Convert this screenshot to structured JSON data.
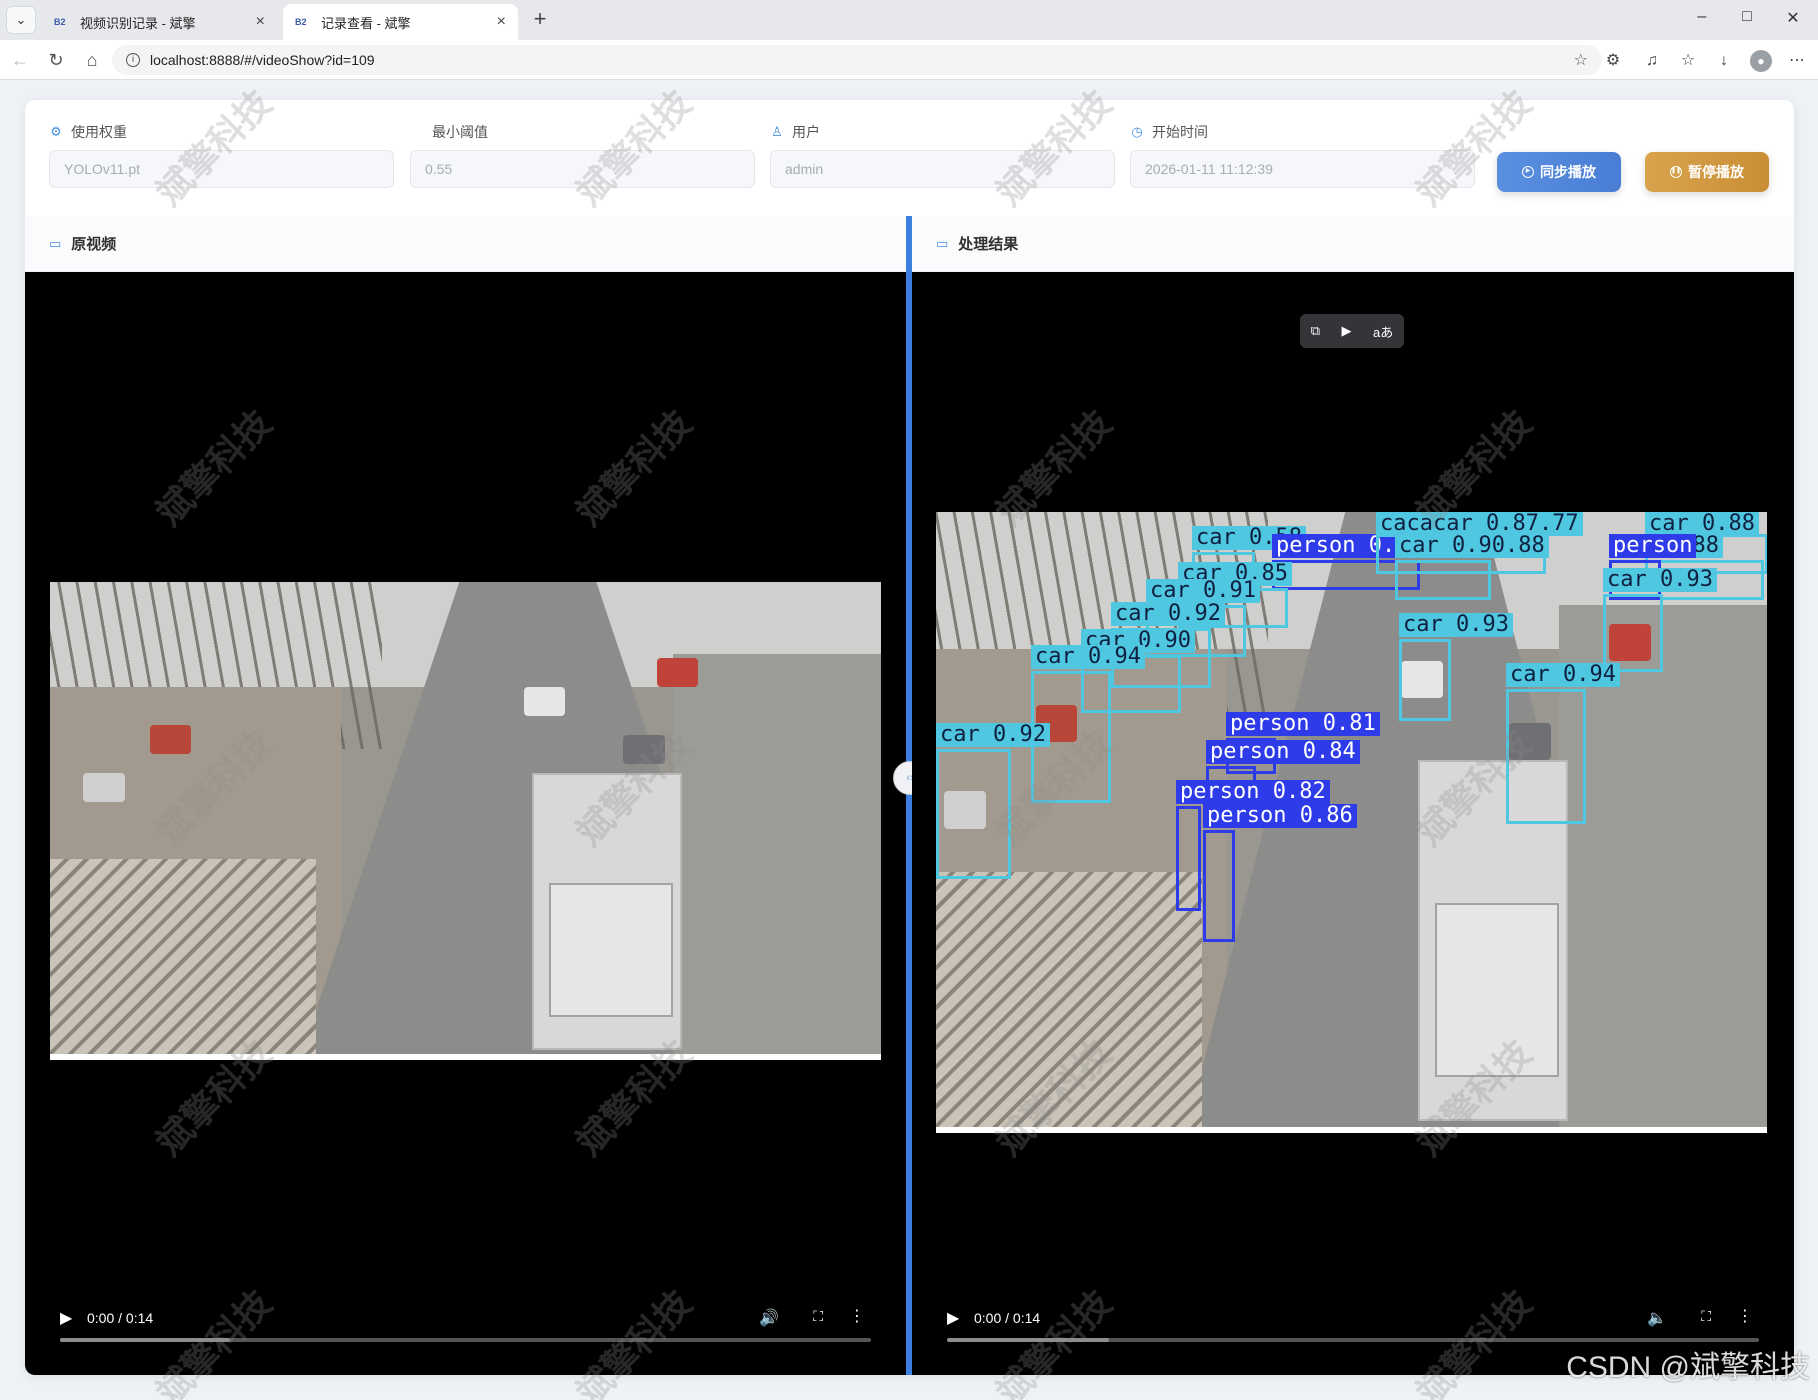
{
  "browser": {
    "tabs": [
      {
        "favicon": "B2",
        "title": "视频识别记录 - 斌擎"
      },
      {
        "favicon": "B2",
        "title": "记录查看 - 斌擎"
      }
    ],
    "url": "localhost:8888/#/videoShow?id=109"
  },
  "form": {
    "weights": {
      "label": "使用权重",
      "value": "YOLOv11.pt"
    },
    "threshold": {
      "label": "最小阈值",
      "value": "0.55"
    },
    "user": {
      "label": "用户",
      "value": "admin"
    },
    "start_time": {
      "label": "开始时间",
      "value": "2026-01-11 11:12:39"
    },
    "sync_button": "同步播放",
    "pause_button": "暂停播放"
  },
  "panels": {
    "original": {
      "title": "原视频",
      "time": "0:00 / 0:14",
      "progress": 0.0,
      "buffered": 0.21
    },
    "result": {
      "title": "处理结果",
      "time": "0:00 / 0:14",
      "progress": 0.0,
      "buffered": 0.2
    }
  },
  "detections": [
    {
      "cls": "car",
      "label": "car 0.58"
    },
    {
      "cls": "person",
      "label": "person 0.00"
    },
    {
      "cls": "car",
      "label": "cacacar 0.87.77"
    },
    {
      "cls": "car",
      "label": "car 0.90.88"
    },
    {
      "cls": "car",
      "label": "car 0.88"
    },
    {
      "cls": "car",
      "label": "car 0.88"
    },
    {
      "cls": "person",
      "label": "person"
    },
    {
      "cls": "car",
      "label": "car 0.85"
    },
    {
      "cls": "car",
      "label": "car 0.91"
    },
    {
      "cls": "car",
      "label": "car 0.93"
    },
    {
      "cls": "car",
      "label": "car 0.92"
    },
    {
      "cls": "car",
      "label": "car 0.93"
    },
    {
      "cls": "car",
      "label": "car 0.90"
    },
    {
      "cls": "car",
      "label": "car 0.94"
    },
    {
      "cls": "car",
      "label": "car 0.94"
    },
    {
      "cls": "car",
      "label": "car 0.92"
    },
    {
      "cls": "person",
      "label": "person 0.81"
    },
    {
      "cls": "person",
      "label": "person 0.84"
    },
    {
      "cls": "person",
      "label": "person 0.82"
    },
    {
      "cls": "person",
      "label": "person 0.86"
    }
  ],
  "watermark": "斌擎科技",
  "csdn_mark": "CSDN @斌擎科技"
}
